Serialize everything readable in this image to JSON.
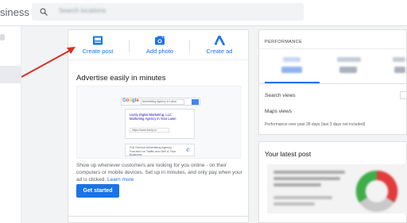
{
  "header": {
    "brand_partial": "siness",
    "search_placeholder": "Search locations"
  },
  "main_card": {
    "actions": [
      {
        "label": "Create post",
        "icon": "create-post-icon"
      },
      {
        "label": "Add photo",
        "icon": "add-photo-icon"
      },
      {
        "label": "Create ad",
        "icon": "google-ads-icon"
      }
    ],
    "advertise": {
      "title": "Advertise easily in minutes",
      "body": "Show up whenever customers are looking for you online - on their computers or mobile devices. Set up in minutes, and only pay when your ad is clicked.",
      "learn_more": "Learn more",
      "cta": "Get started",
      "illustration": {
        "google_logo": "Google",
        "search_query": "Advertising Agency in Lahor",
        "ad_line1": "Lively Digital Marketing, LLC",
        "ad_line2": "Marketing Agency in Your Lawn",
        "ad_url": "https://www.lively.co",
        "ad_desc": "Full Service Advertising Agency Focused on Traffic and Sell & Your Business"
      }
    }
  },
  "performance": {
    "title": "PERFORMANCE",
    "metrics": [
      "Search views",
      "Maps views"
    ],
    "note": "Performance over past 28 days (last 3 days not included)"
  },
  "latest_post": {
    "title": "Your latest post"
  },
  "colors": {
    "accent_blue": "#1a73e8",
    "annotation_red": "#d93025"
  }
}
